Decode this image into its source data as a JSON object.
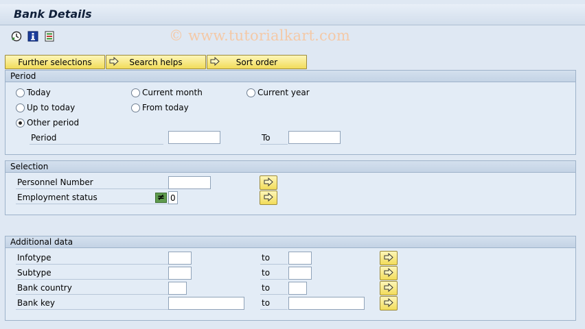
{
  "window": {
    "title": "Bank Details"
  },
  "toolbar": {
    "icons": [
      "execute-icon",
      "info-icon",
      "variants-icon"
    ]
  },
  "watermark": "© www.tutorialkart.com",
  "tabs": [
    {
      "label": "Further selections"
    },
    {
      "label": "Search helps"
    },
    {
      "label": "Sort order"
    }
  ],
  "period": {
    "title": "Period",
    "options": {
      "today": "Today",
      "current_month": "Current month",
      "current_year": "Current year",
      "up_to_today": "Up to today",
      "from_today": "From today",
      "other_period": "Other period"
    },
    "selected": "other_period",
    "period_label": "Period",
    "to_label": "To",
    "from_value": "",
    "to_value": ""
  },
  "selection": {
    "title": "Selection",
    "personnel_number_label": "Personnel Number",
    "personnel_number_value": "",
    "employment_status_label": "Employment status",
    "employment_status_operator": "≠",
    "employment_status_value": "0"
  },
  "additional": {
    "title": "Additional data",
    "to_label": "to",
    "rows": [
      {
        "label": "Infotype",
        "from": "",
        "to": ""
      },
      {
        "label": "Subtype",
        "from": "",
        "to": ""
      },
      {
        "label": "Bank country",
        "from": "",
        "to": ""
      },
      {
        "label": "Bank key",
        "from": "",
        "to": ""
      }
    ]
  },
  "colors": {
    "accent_button": "#f2dc5a",
    "background": "#dfe8f3",
    "watermark": "#f4c9a7"
  }
}
